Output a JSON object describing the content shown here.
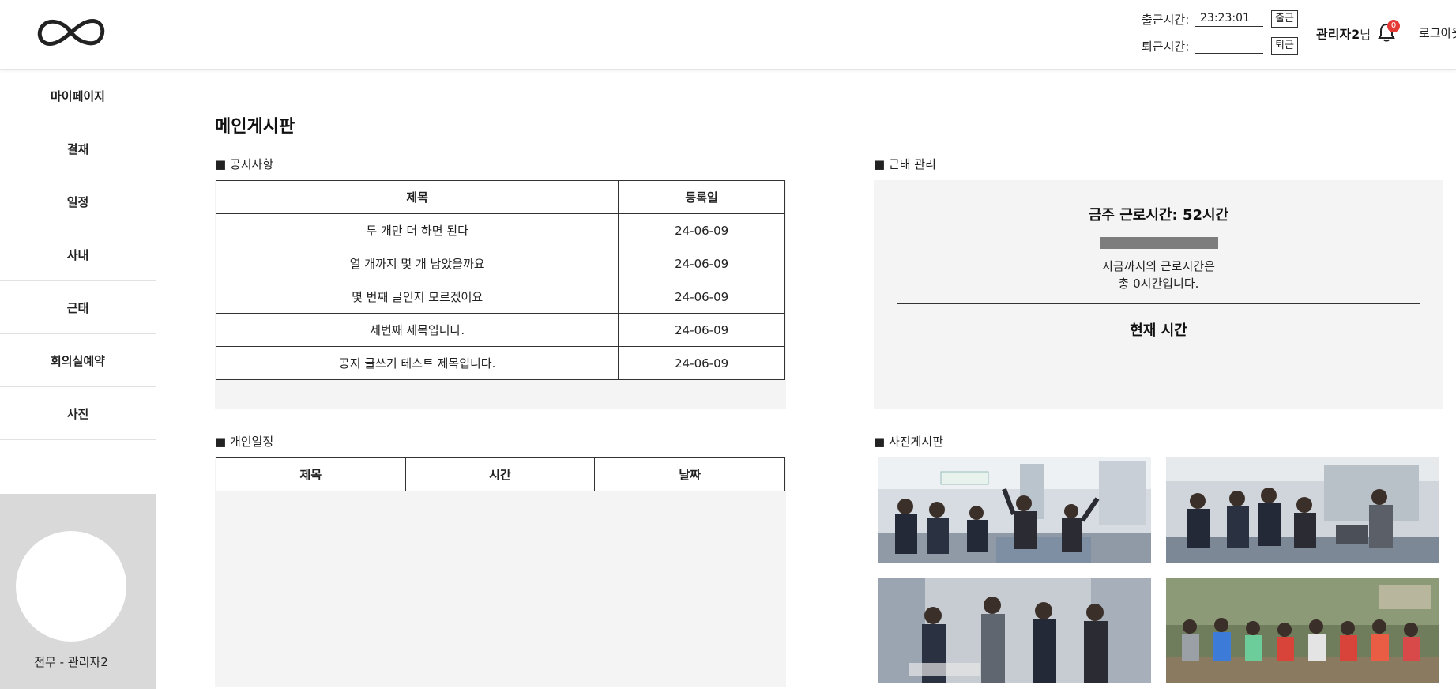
{
  "header": {
    "clock_in_label": "출근시간:",
    "clock_in_value": "23:23:01",
    "clock_in_button": "출근",
    "clock_out_label": "퇴근시간:",
    "clock_out_value": "",
    "clock_out_button": "퇴근",
    "user_name": "관리자2",
    "user_suffix": "님",
    "notification_count": "0",
    "logout_label": "로그아웃",
    "logo_icon": "infinity-icon",
    "bell_icon": "bell-icon"
  },
  "sidebar": {
    "items": [
      {
        "label": "마이페이지"
      },
      {
        "label": "결재"
      },
      {
        "label": "일정"
      },
      {
        "label": "사내"
      },
      {
        "label": "근태"
      },
      {
        "label": "회의실예약"
      },
      {
        "label": "사진"
      }
    ],
    "profile_name": "전무 - 관리자2"
  },
  "main": {
    "title": "메인게시판",
    "notice": {
      "section_title": "■ 공지사항",
      "columns": [
        "제목",
        "등록일"
      ],
      "rows": [
        {
          "title": "두 개만 더 하면 된다",
          "date": "24-06-09"
        },
        {
          "title": "열 개까지 몇 개 남았을까요",
          "date": "24-06-09"
        },
        {
          "title": "몇 번째 글인지 모르겠어요",
          "date": "24-06-09"
        },
        {
          "title": "세번째 제목입니다.",
          "date": "24-06-09"
        },
        {
          "title": "공지 글쓰기 테스트 제목입니다.",
          "date": "24-06-09"
        }
      ]
    },
    "schedule": {
      "section_title": "■ 개인일정",
      "columns": [
        "제목",
        "시간",
        "날짜"
      ]
    },
    "attendance": {
      "section_title": "■ 근태 관리",
      "weekly_hours": "금주 근로시간: 52시간",
      "worked_line1": "지금까지의 근로시간은",
      "worked_line2": "총 0시간입니다.",
      "progress": 0,
      "current_time_label": "현재 시간"
    },
    "photos": {
      "section_title": "■ 사진게시판",
      "items": [
        {
          "alt": "photo-1"
        },
        {
          "alt": "photo-2"
        },
        {
          "alt": "photo-3"
        },
        {
          "alt": "photo-4"
        }
      ]
    }
  }
}
